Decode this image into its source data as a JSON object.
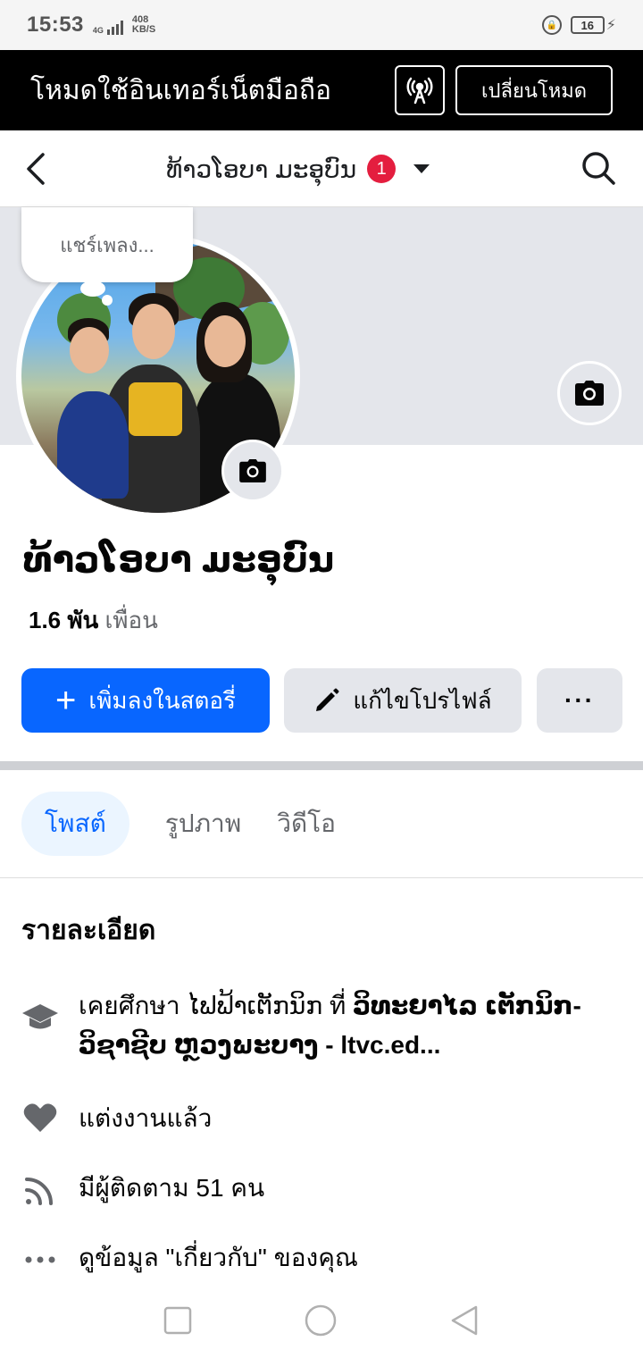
{
  "status": {
    "time": "15:53",
    "network": "4G",
    "speed_value": "408",
    "speed_unit": "KB/S",
    "battery": "16"
  },
  "mode_bar": {
    "text": "โหมดใช้อินเทอร์เน็ตมือถือ",
    "switch_label": "เปลี่ยนโหมด"
  },
  "header": {
    "title": "ທ້າວໂອບາ ມະອຸບົນ",
    "badge_count": "1"
  },
  "note": {
    "text": "แชร์เพลง..."
  },
  "profile": {
    "name": "ທ້າວໂອບາ ມະອຸບົນ",
    "friends_count": "1.6 พัน",
    "friends_label": "เพื่อน"
  },
  "actions": {
    "add_story": "เพิ่มลงในสตอรี่",
    "edit_profile": "แก้ไขโปรไฟล์",
    "more": "···"
  },
  "tabs": [
    {
      "label": "โพสต์",
      "active": true
    },
    {
      "label": "รูปภาพ",
      "active": false
    },
    {
      "label": "วิดีโอ",
      "active": false
    }
  ],
  "details": {
    "title": "รายละเอียด",
    "education_prefix": "เคยศึกษา ໄຟຟ້າເຕັກນິກ ที่ ",
    "education_school": "ວິທະຍາໄລ ເຕັກນິກ-ວິຊາຊີບ ຫຼວງພະບາງ - ltvc.ed...",
    "relationship": "แต่งงานแล้ว",
    "followers": "มีผู้ติดตาม 51 คน",
    "about": "ดูข้อมูล \"เกี่ยวกับ\" ของคุณ"
  },
  "colors": {
    "brand_blue": "#0866ff",
    "badge_red": "#e41e3f",
    "mode_bar_bg": "#000000"
  }
}
